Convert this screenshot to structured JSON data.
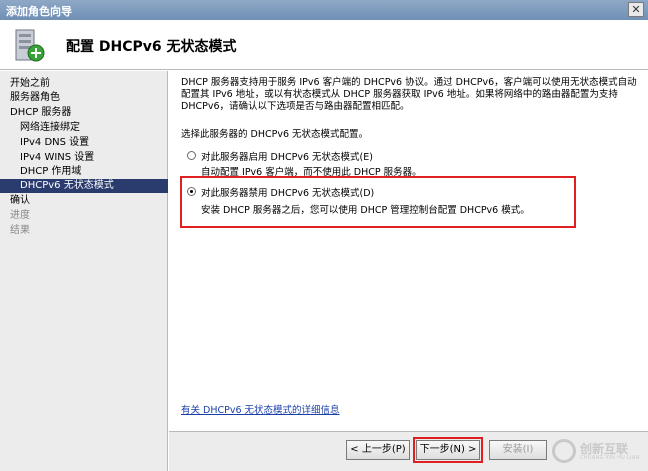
{
  "window": {
    "title": "添加角色向导",
    "close_glyph": "✕"
  },
  "header": {
    "title": "配置 DHCPv6 无状态模式",
    "icon": "server-add-icon"
  },
  "sidebar": {
    "items": [
      {
        "label": "开始之前"
      },
      {
        "label": "服务器角色"
      },
      {
        "label": "DHCP 服务器"
      },
      {
        "label": "网络连接绑定"
      },
      {
        "label": "IPv4 DNS 设置"
      },
      {
        "label": "IPv4 WINS 设置"
      },
      {
        "label": "DHCP 作用域"
      },
      {
        "label": "DHCPv6 无状态模式",
        "active": true
      },
      {
        "label": "确认"
      },
      {
        "label": "进度"
      },
      {
        "label": "结果"
      }
    ]
  },
  "main": {
    "description": "DHCP 服务器支持用于服务 IPv6 客户端的 DHCPv6 协议。通过 DHCPv6，客户端可以使用无状态模式自动配置其 IPv6 地址，或以有状态模式从 DHCP 服务器获取 IPv6 地址。如果将网络中的路由器配置为支持 DHCPv6，请确认以下选项是否与路由器配置相匹配。",
    "prompt": "选择此服务器的 DHCPv6 无状态模式配置。",
    "option_enable": {
      "label": "对此服务器启用 DHCPv6 无状态模式(E)",
      "description": "自动配置 IPv6 客户端，而不使用此 DHCP 服务器。",
      "selected": false
    },
    "option_disable": {
      "label": "对此服务器禁用 DHCPv6 无状态模式(D)",
      "description": "安装 DHCP 服务器之后，您可以使用 DHCP 管理控制台配置 DHCPv6 模式。",
      "selected": true
    },
    "help_link": "有关 DHCPv6 无状态模式的详细信息"
  },
  "footer": {
    "back_label": "< 上一步(P)",
    "next_label": "下一步(N) >",
    "install_label": "安装(I)"
  },
  "watermark": {
    "text": "创新互联",
    "subtext": "CHUANG XIN HU LIAN"
  },
  "colors": {
    "sidebar_active": "#2a3b6e",
    "highlight_border": "#e02020",
    "link": "#1a3faa"
  }
}
